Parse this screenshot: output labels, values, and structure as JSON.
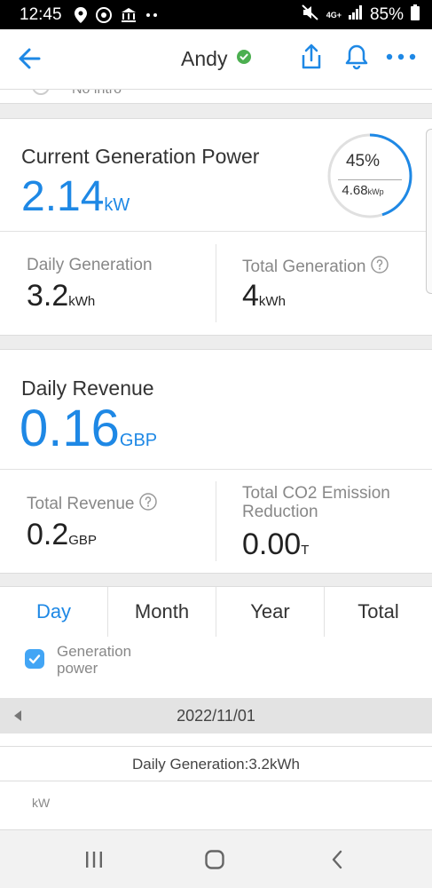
{
  "status_bar": {
    "time": "12:45",
    "icons": [
      "location-icon",
      "chrome-icon",
      "bank-icon",
      "more-dots-icon",
      "mute-icon",
      "4g-icon",
      "signal-icon",
      "battery-icon"
    ],
    "network": "4G+",
    "battery": "85%"
  },
  "header": {
    "title": "Andy",
    "verified": true,
    "accent": "#1e88e5"
  },
  "intro": {
    "text": "No intro"
  },
  "power": {
    "label": "Current Generation Power",
    "value": "2.14",
    "unit": "kW",
    "gauge_percent_text": "45%",
    "gauge_fraction": 0.45,
    "capacity_value": "4.68",
    "capacity_unit": "kWp",
    "daily_label": "Daily Generation",
    "daily_value": "3.2",
    "daily_unit": "kWh",
    "total_label": "Total Generation",
    "total_value": "4",
    "total_unit": "kWh"
  },
  "revenue": {
    "label": "Daily Revenue",
    "value": "0.16",
    "unit": "GBP",
    "total_label": "Total Revenue",
    "total_value": "0.2",
    "total_unit": "GBP",
    "co2_label_line1": "Total CO2 Emission",
    "co2_label_line2": "Reduction",
    "co2_value": "0.00",
    "co2_unit": "T"
  },
  "tabs": [
    {
      "label": "Day",
      "active": true
    },
    {
      "label": "Month",
      "active": false
    },
    {
      "label": "Year",
      "active": false
    },
    {
      "label": "Total",
      "active": false
    }
  ],
  "legend": {
    "label": "Generation power",
    "checked": true
  },
  "date_nav": {
    "date": "2022/11/01"
  },
  "summary": {
    "text": "Daily Generation:3.2kWh"
  },
  "chart": {
    "unit_label": "kW"
  }
}
